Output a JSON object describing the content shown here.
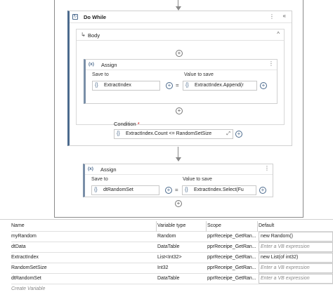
{
  "workflow": {
    "do_while": {
      "title": "Do While",
      "body_title": "Body",
      "condition_label": "Condition",
      "condition_required": "*",
      "condition_value": "ExtractIndex.Count <= RandomSetSize"
    },
    "assign_inner": {
      "title": "Assign",
      "save_to_label": "Save to",
      "value_label": "Value to save",
      "save_to": "ExtractIndex",
      "value": "ExtractIndex.Append(r"
    },
    "assign_outer": {
      "title": "Assign",
      "save_to_label": "Save to",
      "value_label": "Value to save",
      "save_to": "dtRandomSet",
      "value": "ExtractIndex.Select(Fu"
    },
    "icons": {
      "brace": "{}",
      "assign_icon": "(x)",
      "plus": "+",
      "menu": "⋮",
      "collapse": "«",
      "caret": "^",
      "equals": "=",
      "expand": "⤢"
    }
  },
  "variables": {
    "headers": [
      "Name",
      "Variable type",
      "Scope",
      "Default"
    ],
    "rows": [
      {
        "name": "myRandom",
        "type": "Random",
        "scope": "pprReceipe_GetRan...",
        "default": "new Random()",
        "placeholder": false
      },
      {
        "name": "dtData",
        "type": "DataTable",
        "scope": "pprReceipe_GetRan...",
        "default": "Enter a VB expression",
        "placeholder": true
      },
      {
        "name": "ExtractIndex",
        "type": "List<Int32>",
        "scope": "pprReceipe_GetRan...",
        "default": "new List(of int32)",
        "placeholder": false
      },
      {
        "name": "RandomSetSize",
        "type": "Int32",
        "scope": "pprReceipe_GetRan...",
        "default": "Enter a VB expression",
        "placeholder": true
      },
      {
        "name": "dtRandomSet",
        "type": "DataTable",
        "scope": "pprReceipe_GetRan...",
        "default": "Enter a VB expression",
        "placeholder": true
      }
    ],
    "create_label": "Create Variable"
  }
}
